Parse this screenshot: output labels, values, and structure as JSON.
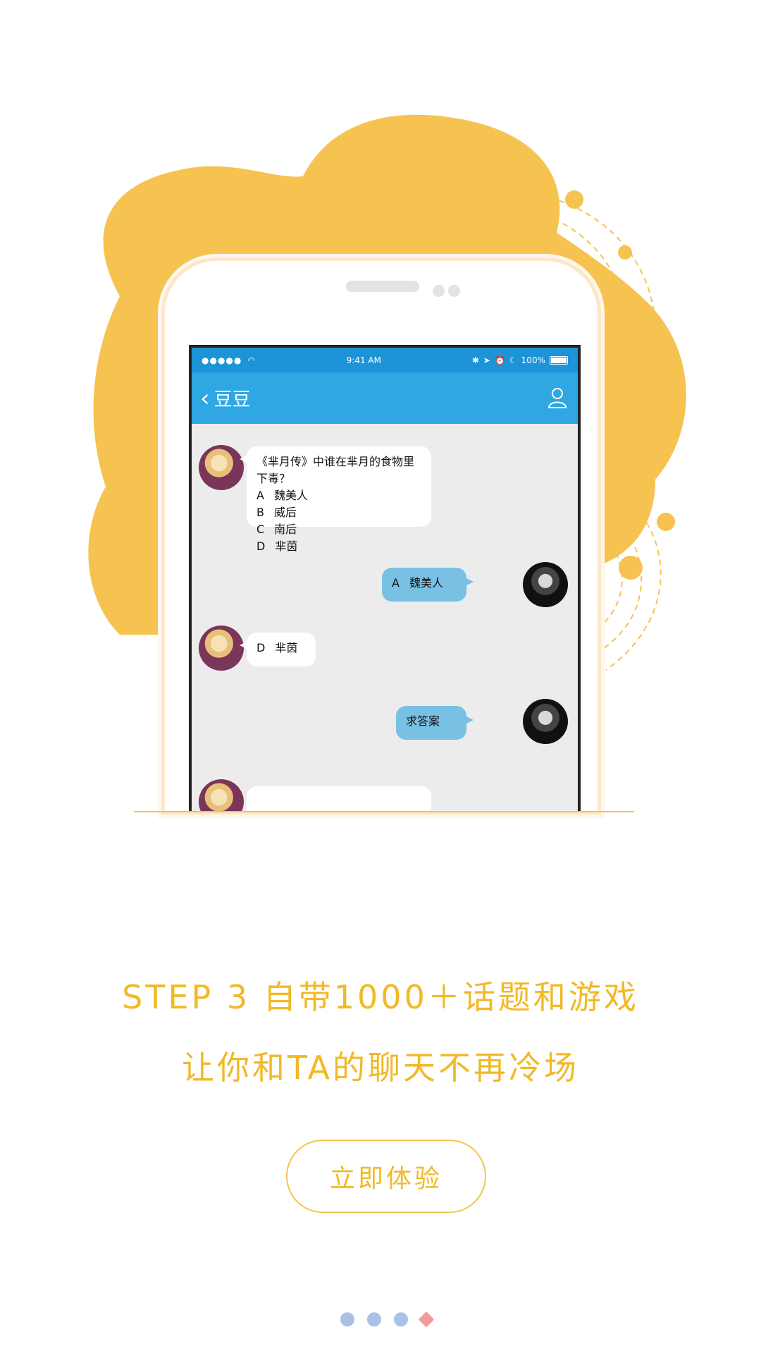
{
  "illustration": {
    "colors": {
      "blob": "#f6c350",
      "accent": "#f2b927",
      "phone_shadow": "#fde7c9"
    }
  },
  "status_bar": {
    "signal": "●●●●●",
    "time": "9:41 AM",
    "battery": "100%"
  },
  "chat": {
    "title": "豆豆",
    "messages": [
      {
        "side": "left",
        "avatar": "female",
        "question": "《芈月传》中谁在芈月的食物里下毒？",
        "options": [
          {
            "letter": "A",
            "text": "魏美人"
          },
          {
            "letter": "B",
            "text": "威后"
          },
          {
            "letter": "C",
            "text": "南后"
          },
          {
            "letter": "D",
            "text": "芈茵"
          }
        ]
      },
      {
        "side": "right",
        "avatar": "male",
        "letter": "A",
        "text": "魏美人"
      },
      {
        "side": "left",
        "avatar": "female",
        "letter": "D",
        "text": "芈茵"
      },
      {
        "side": "right",
        "avatar": "male",
        "text": "求答案"
      }
    ]
  },
  "headline": "STEP 3 自带1000＋话题和游戏",
  "subline": "让你和TA的聊天不再冷场",
  "cta_label": "立即体验",
  "pager": {
    "count": 4,
    "active_index": 3
  }
}
